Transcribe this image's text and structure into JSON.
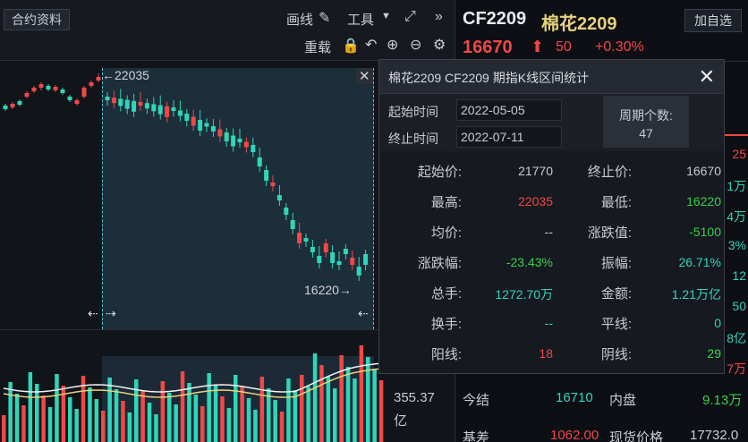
{
  "toolbar": {
    "contract_info": "合约资料",
    "draw_label": "画线",
    "tools_label": "工具",
    "reload_label": "重载"
  },
  "chart": {
    "high_label": "←22035",
    "low_label": "16220→",
    "volume_value": "355.37",
    "volume_unit": "亿"
  },
  "quote": {
    "code": "CF2209",
    "name": "棉花2209",
    "add_watch": "加自选",
    "price": "16670",
    "change": "50",
    "change_pct": "+0.30%",
    "edge_values": [
      "25",
      "1万",
      "4万",
      "3%",
      "12",
      "50",
      "8亿",
      "7万"
    ],
    "settle_label": "今结",
    "settle_value": "16710",
    "inner_label": "内盘",
    "inner_value": "9.13万",
    "basis_label": "基差",
    "basis_value": "1062.00",
    "spot_label": "现货价格",
    "spot_value": "17732.0"
  },
  "dialog": {
    "title": "棉花2209  CF2209  期指K线区间统计",
    "start_time_label": "起始时间",
    "start_time": "2022-05-05",
    "end_time_label": "终止时间",
    "end_time": "2022-07-11",
    "period_label": "周期个数:",
    "period_count": "47",
    "stats": {
      "start_price_label": "起始价:",
      "start_price": "21770",
      "end_price_label": "终止价:",
      "end_price": "16670",
      "high_label": "最高:",
      "high": "22035",
      "low_label": "最低:",
      "low": "16220",
      "avg_label": "均价:",
      "avg": "--",
      "change_label": "涨跌值:",
      "change": "-5100",
      "change_pct_label": "涨跌幅:",
      "change_pct": "-23.43%",
      "amplitude_label": "振幅:",
      "amplitude": "26.71%",
      "volume_label": "总手:",
      "volume": "1272.70万",
      "amount_label": "金额:",
      "amount": "1.21万亿",
      "turnover_label": "换手:",
      "turnover": "--",
      "flat_label": "平线:",
      "flat": "0",
      "up_label": "阳线:",
      "up": "18",
      "down_label": "阴线:",
      "down": "29"
    }
  },
  "colors": {
    "up": "#f04848",
    "down": "#2fd6b9",
    "green": "#35d24c",
    "cyan": "#4fc3d9",
    "name_gold": "#e8d27a"
  }
}
